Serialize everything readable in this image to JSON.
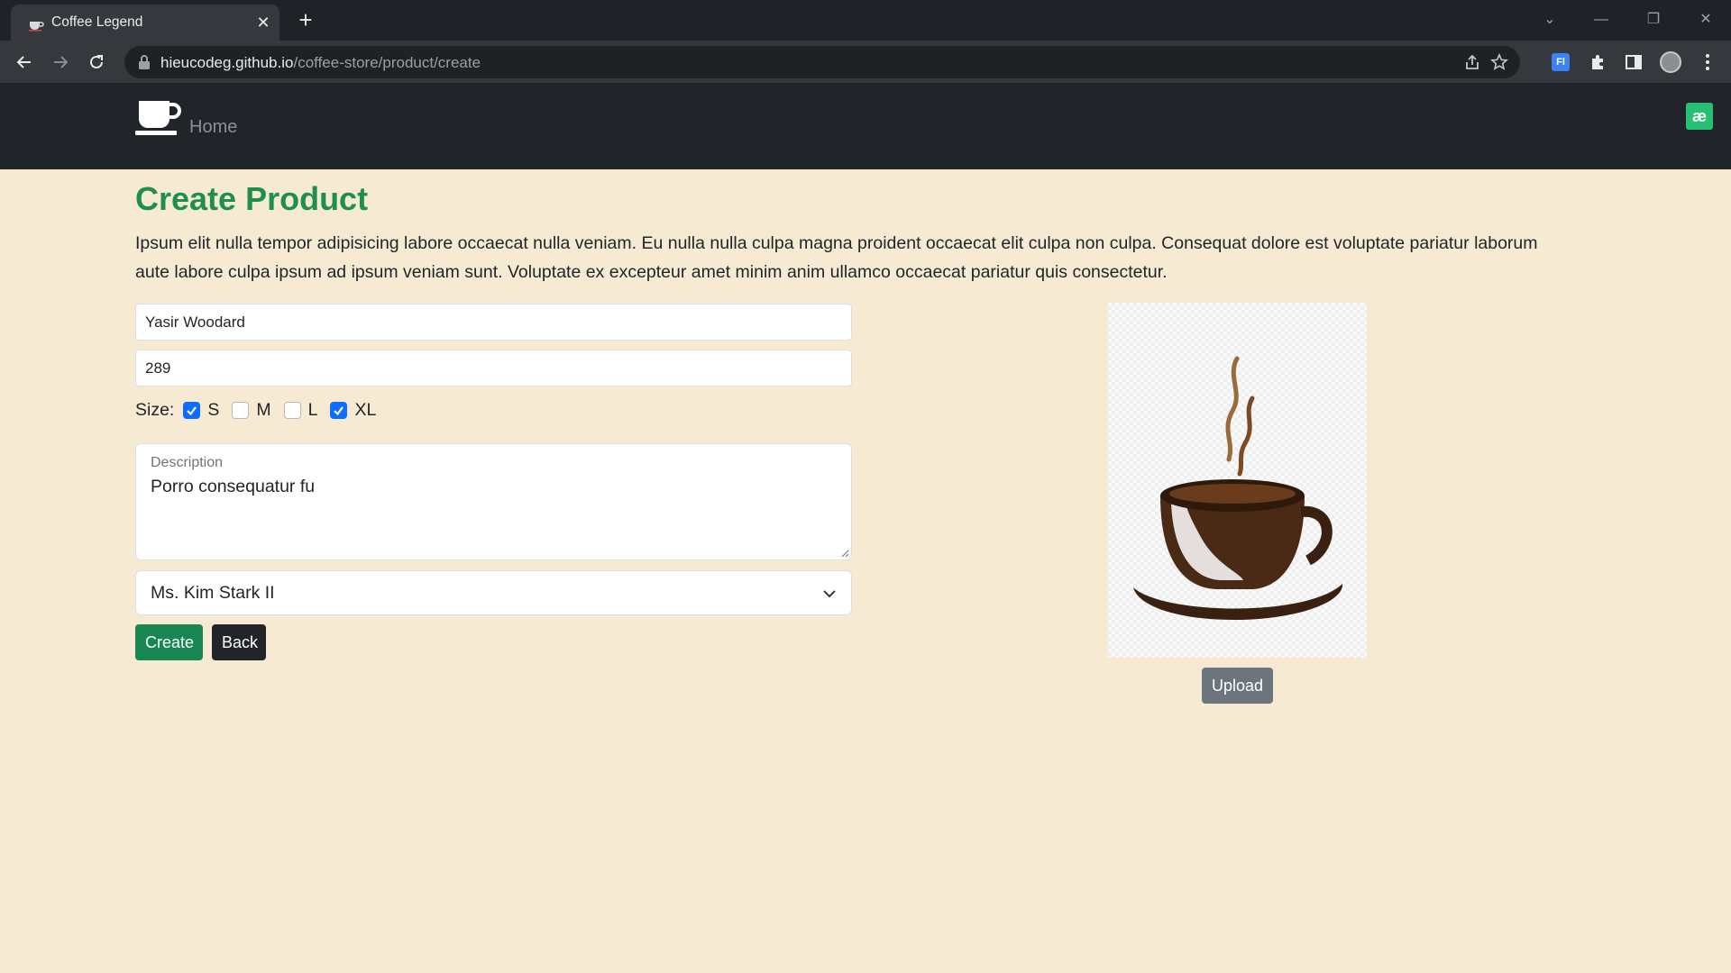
{
  "browser": {
    "tab_title": "Coffee Legend",
    "url_host": "hieucodeg.github.io",
    "url_path": "/coffee-store/product/create"
  },
  "navbar": {
    "home_label": "Home",
    "extension_badge": "æ"
  },
  "page": {
    "title": "Create Product",
    "intro": "Ipsum elit nulla tempor adipisicing labore occaecat nulla veniam. Eu nulla nulla culpa magna proident occaecat elit culpa non culpa. Consequat dolore est voluptate pariatur laborum aute labore culpa ipsum ad ipsum veniam sunt. Voluptate ex excepteur amet minim anim ullamco occaecat pariatur quis consectetur."
  },
  "form": {
    "name_value": "Yasir Woodard",
    "price_value": "289",
    "size_label": "Size:",
    "sizes": [
      {
        "label": "S",
        "checked": true
      },
      {
        "label": "M",
        "checked": false
      },
      {
        "label": "L",
        "checked": false
      },
      {
        "label": "XL",
        "checked": true
      }
    ],
    "description_label": "Description",
    "description_value": "Porro consequatur fu",
    "category_selected": "Ms. Kim Stark II",
    "create_label": "Create",
    "back_label": "Back",
    "upload_label": "Upload"
  },
  "colors": {
    "page_bg": "#f6ead3",
    "accent_green": "#1e8f4e",
    "checkbox_blue": "#0d6efd"
  }
}
